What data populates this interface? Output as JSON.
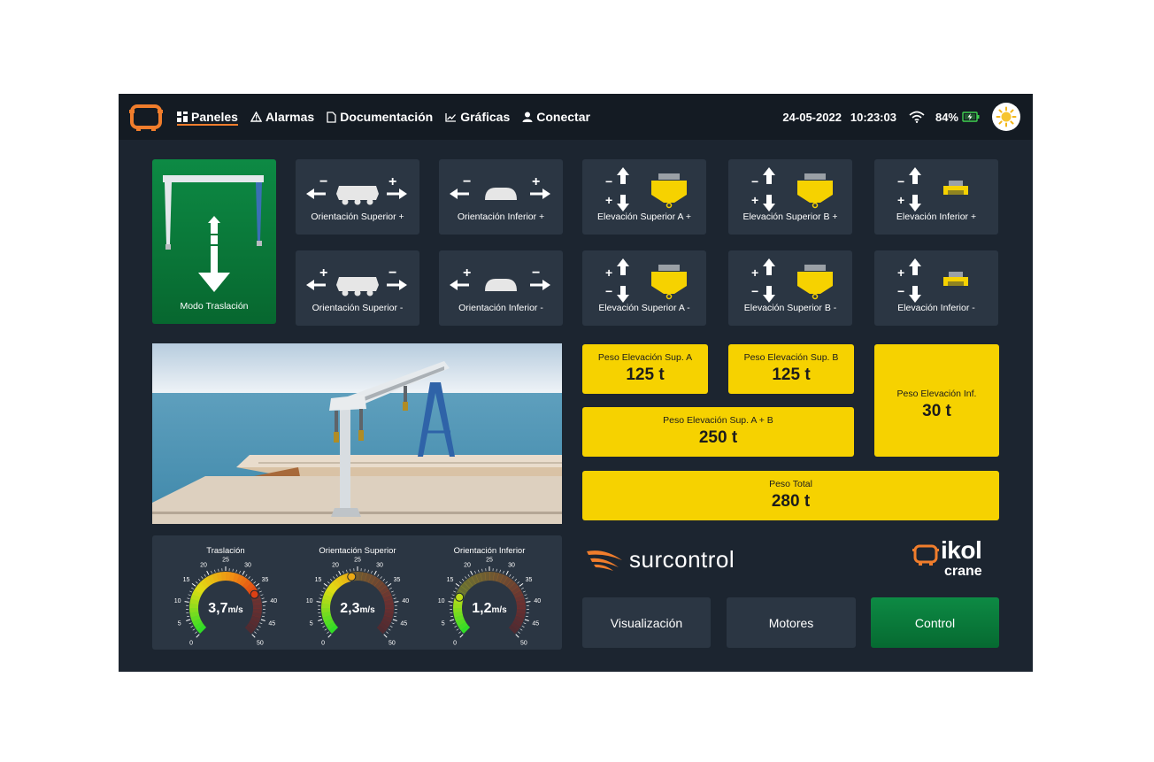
{
  "nav": {
    "items": [
      {
        "label": "Paneles",
        "icon": "grid-icon",
        "active": true
      },
      {
        "label": "Alarmas",
        "icon": "warning-icon",
        "active": false
      },
      {
        "label": "Documentación",
        "icon": "document-icon",
        "active": false
      },
      {
        "label": "Gráficas",
        "icon": "chart-icon",
        "active": false
      },
      {
        "label": "Conectar",
        "icon": "user-icon",
        "active": false
      }
    ]
  },
  "status": {
    "date": "24-05-2022",
    "time": "10:23:03",
    "battery": "84%"
  },
  "controls": {
    "mode": "Modo Traslación",
    "orient_sup_plus": "Orientación Superior +",
    "orient_inf_plus": "Orientación Inferior +",
    "elev_sup_a_plus": "Elevación Superior A +",
    "elev_sup_b_plus": "Elevación Superior B +",
    "elev_inf_plus": "Elevación Inferior +",
    "orient_sup_minus": "Orientación Superior -",
    "orient_inf_minus": "Orientación Inferior -",
    "elev_sup_a_minus": "Elevación Superior A -",
    "elev_sup_b_minus": "Elevación Superior B -",
    "elev_inf_minus": "Elevación Inferior -"
  },
  "weights": {
    "sup_a": {
      "label": "Peso Elevación Sup. A",
      "value": "125 t"
    },
    "sup_b": {
      "label": "Peso Elevación Sup. B",
      "value": "125 t"
    },
    "sup_ab": {
      "label": "Peso Elevación Sup. A + B",
      "value": "250 t"
    },
    "inf": {
      "label": "Peso Elevación Inf.",
      "value": "30 t"
    },
    "total": {
      "label": "Peso Total",
      "value": "280 t"
    }
  },
  "gauges": [
    {
      "title": "Traslación",
      "value": "3,7",
      "unit": "m/s",
      "speed": 37
    },
    {
      "title": "Orientación Superior",
      "value": "2,3",
      "unit": "m/s",
      "speed": 23
    },
    {
      "title": "Orientación Inferior",
      "value": "1,2",
      "unit": "m/s",
      "speed": 12
    }
  ],
  "gauge_ticks": [
    "0",
    "5",
    "10",
    "15",
    "20",
    "25",
    "30",
    "35",
    "40",
    "45",
    "50"
  ],
  "brand": {
    "surcontrol": "surcontrol",
    "ikol": "ikol",
    "crane": "crane"
  },
  "buttons": {
    "visualizacion": "Visualización",
    "motores": "Motores",
    "control": "Control"
  },
  "colors": {
    "accent": "#f07d2c",
    "weight_yellow": "#f6d200",
    "active_green": "#0b7a3c",
    "panel": "#2b3643",
    "background": "#1c2530"
  }
}
